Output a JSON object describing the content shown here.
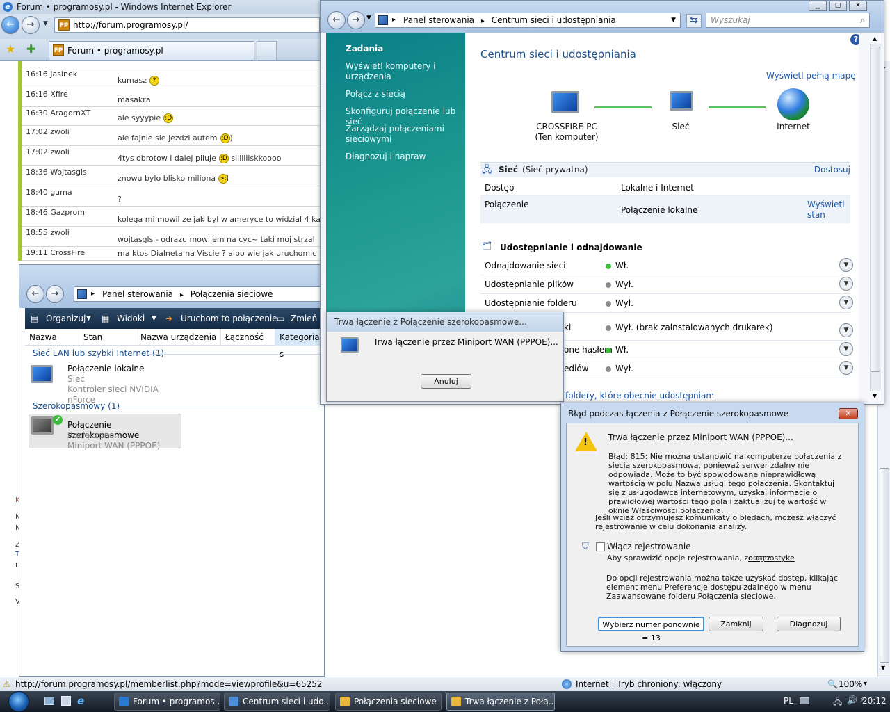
{
  "ie": {
    "title": "Forum • programosy.pl - Windows Internet Explorer",
    "url": "http://forum.programosy.pl/",
    "tab": "Forum • programosy.pl",
    "status_url": "http://forum.programosy.pl/memberlist.php?mode=viewprofile&u=65252",
    "zone": "Internet | Tryb chroniony: włączony",
    "zoom": "100%",
    "zoom_arrow": "▾"
  },
  "chat": [
    {
      "t": "16:16 Jasinek",
      "m": "kumasz",
      "smile": "?"
    },
    {
      "t": "16:16 Xfire",
      "m": "masakra",
      "smile": ""
    },
    {
      "t": "16:30 AragornXT",
      "m": "ale syyypie",
      "smile": ":D"
    },
    {
      "t": "17:02 zwoli",
      "m": "ale fajnie sie jezdzi autem",
      "smile": ":D",
      "after": ")"
    },
    {
      "t": "17:02 zwoli",
      "m": "4tys obrotow i dalej piluje",
      "smile": ":D",
      "after": " sliiiiiiskkoooo"
    },
    {
      "t": "18:36 Wojtasgls",
      "m": "znowu bylo blisko miliona",
      "smile": ">:("
    },
    {
      "t": "18:40 guma",
      "m": "?",
      "smile": ""
    },
    {
      "t": "18:46 Gazprom",
      "m": "kolega mi mowil ze jak byl w ameryce to widzial 4 ka",
      "smile": ""
    },
    {
      "t": "18:55 zwoli",
      "m": "wojtasgls - odrazu mowilem na cyc~ taki moj strzal",
      "smile": ""
    },
    {
      "t": "19:11 CrossFire",
      "m": "ma ktos Dialneta na Viscie ? albo wie jak uruchomic",
      "smile": ""
    }
  ],
  "cp": {
    "breadcrumb": [
      "Panel sterowania",
      "Centrum sieci i udostępniania"
    ],
    "search_placeholder": "Wyszukaj",
    "sidebar_heading": "Zadania",
    "sidebar_items": [
      "Wyświetl komputery i urządzenia",
      "Połącz z siecią",
      "Skonfiguruj połączenie lub sieć",
      "Zarządzaj połączeniami sieciowymi",
      "Diagnozuj i napraw"
    ],
    "title": "Centrum sieci i udostępniania",
    "full_map": "Wyświetl pełną mapę",
    "map": {
      "pc": "CROSSFIRE-PC",
      "pc_sub": "(Ten komputer)",
      "net": "Sieć",
      "internet": "Internet"
    },
    "network": {
      "name": "Sieć",
      "type": "(Sieć prywatna)",
      "customize": "Dostosuj",
      "access_k": "Dostęp",
      "access_v": "Lokalne i Internet",
      "conn_k": "Połączenie",
      "conn_v": "Połączenie lokalne",
      "view_status": "Wyświetl stan"
    },
    "sharing_title": "Udostępnianie i odnajdowanie",
    "sharing": [
      {
        "k": "Odnajdowanie sieci",
        "v": "Wł.",
        "on": true
      },
      {
        "k": "Udostępnianie plików",
        "v": "Wył.",
        "on": false
      },
      {
        "k": "Udostępnianie folderu",
        "v": "Wył.",
        "on": false
      },
      {
        "k": "ki",
        "v": "Wył. (brak zainstalowanych drukarek)",
        "on": false
      },
      {
        "k": "one hasłem",
        "v": "Wł.",
        "on": true
      },
      {
        "k": "ediów",
        "v": "Wył.",
        "on": false
      }
    ],
    "bottom_link": "foldery, które obecnie udostępniam"
  },
  "nc": {
    "breadcrumb": [
      "Panel sterowania",
      "Połączenia sieciowe"
    ],
    "toolbar": [
      "Organizuj",
      "Widoki",
      "Uruchom to połączenie",
      "Zmień n"
    ],
    "columns": [
      "Nazwa",
      "Stan",
      "Nazwa urządzenia",
      "Łączność",
      "Kategoria s"
    ],
    "group1": "Sieć LAN lub szybki Internet (1)",
    "conn1": {
      "name": "Połączenie lokalne",
      "l2": "Sieć",
      "l3": "Kontroler sieci NVIDIA nForce"
    },
    "group2": "Szerokopasmowy (1)",
    "conn2": {
      "name": "Połączenie szerokopasmowe",
      "l2": "Rozłączono",
      "l3": "Miniport WAN (PPPOE)"
    }
  },
  "dlg1": {
    "title": "Trwa łączenie z Połączenie szerokopasmowe...",
    "msg": "Trwa łączenie przez Miniport WAN (PPPOE)...",
    "cancel": "Anuluj"
  },
  "dlg2": {
    "title": "Błąd podczas łączenia z Połączenie szerokopasmowe",
    "close_x": "✕",
    "head": "Trwa łączenie przez Miniport WAN (PPPOE)...",
    "error": "Błąd: 815: Nie można ustanowić na komputerze połączenia z siecią szerokopasmową, ponieważ serwer zdalny nie odpowiada. Może to być spowodowane nieprawidłową wartością w polu Nazwa usługi tego połączenia. Skontaktuj się z usługodawcą internetowym, uzyskaj informacje o prawidłowej wartości tego pola i zaktualizuj tę wartość w oknie Właściwości połączenia.",
    "hint": "Jeśli wciąż otrzymujesz komunikaty o błędach, możesz włączyć rejestrowanie w celu dokonania analizy.",
    "checkbox": "Włącz rejestrowanie",
    "check_hint": "Aby sprawdzić opcje rejestrowania, zobacz",
    "check_link": "diagnostyke",
    "note": "Do opcji rejestrowania można także uzyskać dostęp, klikając element menu Preferencje dostępu zdalnego w menu Zaawansowane folderu Połączenia sieciowe.",
    "redial": "Wybierz numer ponownie = 13",
    "close": "Zamknij",
    "diag": "Diagnozuj"
  },
  "taskbar": {
    "items": [
      "Forum • programos...",
      "Centrum sieci i udo...",
      "Połączenia sieciowe",
      "Trwa łączenie z Połą..."
    ],
    "lang": "PL",
    "time": "20:12"
  },
  "colors": {
    "accent": "#1c4f8d",
    "green": "#5cc05c",
    "on": "#3dbb3d",
    "off": "#8a8a8a"
  }
}
